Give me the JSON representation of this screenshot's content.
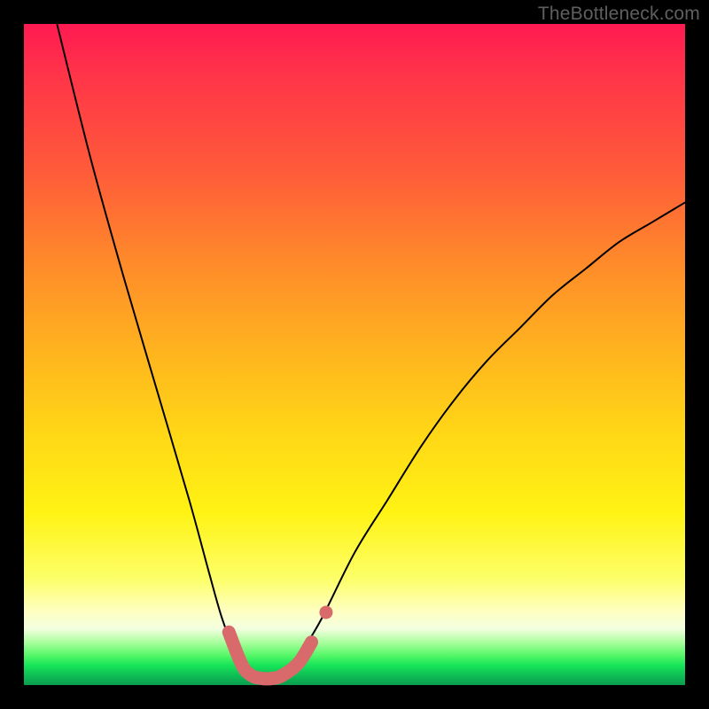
{
  "watermark": "TheBottleneck.com",
  "chart_data": {
    "type": "line",
    "title": "",
    "xlabel": "",
    "ylabel": "",
    "ylim": [
      0,
      100
    ],
    "xlim": [
      0,
      100
    ],
    "series": [
      {
        "name": "bottleneck-curve",
        "x": [
          5,
          10,
          15,
          20,
          25,
          28,
          30,
          32,
          34,
          36,
          38,
          40,
          42,
          45,
          50,
          55,
          60,
          65,
          70,
          75,
          80,
          85,
          90,
          95,
          100
        ],
        "values": [
          100,
          80,
          62,
          45,
          28,
          17,
          10,
          5,
          2,
          1,
          1,
          2,
          5,
          10,
          20,
          28,
          36,
          43,
          49,
          54,
          59,
          63,
          67,
          70,
          73
        ]
      }
    ],
    "highlight": {
      "name": "optimal-range",
      "x": [
        31,
        33,
        34.5,
        36,
        37.5,
        39,
        41.5,
        43.5
      ],
      "values": [
        8,
        3,
        1.4,
        1,
        1,
        1.4,
        3.3,
        6.5
      ]
    }
  },
  "colors": {
    "curve": "#000000",
    "highlight": "#d86a6c"
  }
}
